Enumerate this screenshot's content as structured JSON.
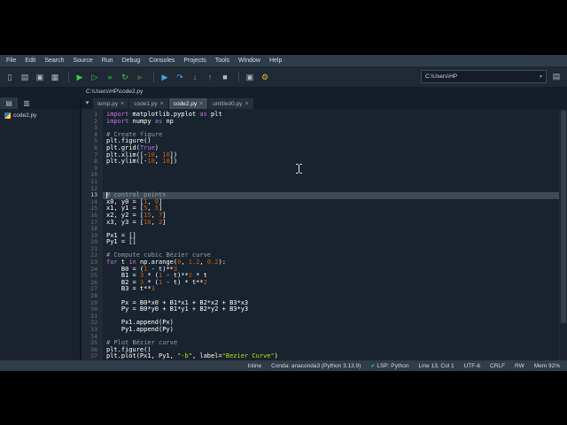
{
  "menu": [
    "File",
    "Edit",
    "Search",
    "Source",
    "Run",
    "Debug",
    "Consoles",
    "Projects",
    "Tools",
    "Window",
    "Help"
  ],
  "toolbar": {
    "working_dir": "C:\\Users\\HP",
    "icons": [
      {
        "name": "new-file-icon",
        "glyph": "▯",
        "color": "#a9bac6"
      },
      {
        "name": "open-file-icon",
        "glyph": "▤",
        "color": "#a9bac6"
      },
      {
        "name": "save-file-icon",
        "glyph": "▣",
        "color": "#a9bac6"
      },
      {
        "name": "save-all-icon",
        "glyph": "▦",
        "color": "#a9bac6"
      },
      {
        "sep": true
      },
      {
        "name": "run-file-icon",
        "glyph": "▶",
        "color": "#45c545"
      },
      {
        "name": "run-cell-icon",
        "glyph": "▷",
        "color": "#45c545"
      },
      {
        "name": "run-cell-advance-icon",
        "glyph": "»",
        "color": "#45c545"
      },
      {
        "name": "rerun-cell-icon",
        "glyph": "↻",
        "color": "#45c545"
      },
      {
        "name": "run-selection-icon",
        "glyph": "▹",
        "color": "#45c545"
      },
      {
        "sep": true
      },
      {
        "name": "debug-file-icon",
        "glyph": "▶",
        "color": "#4aa3df"
      },
      {
        "name": "step-over-icon",
        "glyph": "↷",
        "color": "#4aa3df"
      },
      {
        "name": "step-into-icon",
        "glyph": "↓",
        "color": "#4aa3df"
      },
      {
        "name": "step-out-icon",
        "glyph": "↑",
        "color": "#4aa3df"
      },
      {
        "name": "stop-debug-icon",
        "glyph": "■",
        "color": "#a9bac6"
      },
      {
        "sep": true
      },
      {
        "name": "maximize-pane-icon",
        "glyph": "▣",
        "color": "#a9bac6"
      },
      {
        "name": "preferences-icon",
        "glyph": "⚙",
        "color": "#ddb62b"
      }
    ]
  },
  "pathbar": {
    "path": "C:\\Users\\HP\\code2.py"
  },
  "sidebar": {
    "tabs": [
      {
        "name": "sidebar-tab-1",
        "icon_name": "pane-list-icon",
        "glyph": "▤"
      },
      {
        "name": "sidebar-tab-2",
        "icon_name": "pane-grid-icon",
        "glyph": "▥"
      }
    ],
    "items": [
      {
        "label": "code2.py"
      }
    ]
  },
  "editor": {
    "tabs": [
      {
        "label": "temp.py",
        "active": false
      },
      {
        "label": "code1.py",
        "active": false
      },
      {
        "label": "code2.py",
        "active": true
      },
      {
        "label": "untitled0.py",
        "active": false
      }
    ],
    "current_line": 13,
    "lines": [
      {
        "n": 1,
        "t": [
          [
            "k",
            "import"
          ],
          [
            "n",
            " matplotlib.pyplot "
          ],
          [
            "k",
            "as"
          ],
          [
            "n",
            " plt"
          ]
        ]
      },
      {
        "n": 2,
        "t": [
          [
            "k",
            "import"
          ],
          [
            "n",
            " numpy "
          ],
          [
            "k",
            "as"
          ],
          [
            "n",
            " np"
          ]
        ]
      },
      {
        "n": 3,
        "t": []
      },
      {
        "n": 4,
        "t": [
          [
            "c",
            "# Create figure"
          ]
        ]
      },
      {
        "n": 5,
        "t": [
          [
            "n",
            "plt.figure()"
          ]
        ]
      },
      {
        "n": 6,
        "t": [
          [
            "n",
            "plt.grid("
          ],
          [
            "k",
            "True"
          ],
          [
            "n",
            ")"
          ]
        ]
      },
      {
        "n": 7,
        "t": [
          [
            "n",
            "plt.xlim([-"
          ],
          [
            "d",
            "10"
          ],
          [
            "n",
            ", "
          ],
          [
            "d",
            "10"
          ],
          [
            "n",
            "])"
          ]
        ]
      },
      {
        "n": 8,
        "t": [
          [
            "n",
            "plt.ylim([-"
          ],
          [
            "d",
            "10"
          ],
          [
            "n",
            ", "
          ],
          [
            "d",
            "10"
          ],
          [
            "n",
            "])"
          ]
        ]
      },
      {
        "n": 9,
        "t": []
      },
      {
        "n": 10,
        "t": []
      },
      {
        "n": 11,
        "t": []
      },
      {
        "n": 12,
        "t": []
      },
      {
        "n": 13,
        "t": [
          [
            "c",
            "# control points"
          ]
        ]
      },
      {
        "n": 14,
        "t": [
          [
            "n",
            "x0, y0 = ["
          ],
          [
            "d",
            "1"
          ],
          [
            "n",
            ", "
          ],
          [
            "d",
            "0"
          ],
          [
            "n",
            "]"
          ]
        ]
      },
      {
        "n": 15,
        "t": [
          [
            "n",
            "x1, y1 = ["
          ],
          [
            "d",
            "5"
          ],
          [
            "n",
            ", "
          ],
          [
            "d",
            "5"
          ],
          [
            "n",
            "]"
          ]
        ]
      },
      {
        "n": 16,
        "t": [
          [
            "n",
            "x2, y2 = ["
          ],
          [
            "d",
            "15"
          ],
          [
            "n",
            ", "
          ],
          [
            "d",
            "7"
          ],
          [
            "n",
            "]"
          ]
        ]
      },
      {
        "n": 17,
        "t": [
          [
            "n",
            "x3, y3 = ["
          ],
          [
            "d",
            "10"
          ],
          [
            "n",
            ", "
          ],
          [
            "d",
            "2"
          ],
          [
            "n",
            "]"
          ]
        ]
      },
      {
        "n": 18,
        "t": []
      },
      {
        "n": 19,
        "t": [
          [
            "n",
            "Px1 = []"
          ]
        ]
      },
      {
        "n": 20,
        "t": [
          [
            "n",
            "Py1 = []"
          ]
        ]
      },
      {
        "n": 21,
        "t": []
      },
      {
        "n": 22,
        "t": [
          [
            "c",
            "# Compute cubic Bézier curve"
          ]
        ]
      },
      {
        "n": 23,
        "t": [
          [
            "k",
            "for"
          ],
          [
            "n",
            " t "
          ],
          [
            "k",
            "in"
          ],
          [
            "n",
            " np.arange("
          ],
          [
            "d",
            "0"
          ],
          [
            "n",
            ", "
          ],
          [
            "d",
            "1.2"
          ],
          [
            "n",
            ", "
          ],
          [
            "d",
            "0.2"
          ],
          [
            "n",
            "):"
          ]
        ]
      },
      {
        "n": 24,
        "t": [
          [
            "n",
            "    B0 = ("
          ],
          [
            "d",
            "1"
          ],
          [
            "n",
            " - t)**"
          ],
          [
            "d",
            "3"
          ]
        ]
      },
      {
        "n": 25,
        "t": [
          [
            "n",
            "    B1 = "
          ],
          [
            "d",
            "3"
          ],
          [
            "n",
            " * ("
          ],
          [
            "d",
            "1"
          ],
          [
            "n",
            " - t)**"
          ],
          [
            "d",
            "2"
          ],
          [
            "n",
            " * t"
          ]
        ]
      },
      {
        "n": 26,
        "t": [
          [
            "n",
            "    B2 = "
          ],
          [
            "d",
            "3"
          ],
          [
            "n",
            " * ("
          ],
          [
            "d",
            "1"
          ],
          [
            "n",
            " - t) * t**"
          ],
          [
            "d",
            "2"
          ]
        ]
      },
      {
        "n": 27,
        "t": [
          [
            "n",
            "    B3 = t**"
          ],
          [
            "d",
            "3"
          ]
        ]
      },
      {
        "n": 28,
        "t": []
      },
      {
        "n": 29,
        "t": [
          [
            "n",
            "    Px = B0*x0 + B1*x1 + B2*x2 + B3*x3"
          ]
        ]
      },
      {
        "n": 30,
        "t": [
          [
            "n",
            "    Py = B0*y0 + B1*y1 + B2*y2 + B3*y3"
          ]
        ]
      },
      {
        "n": 31,
        "t": []
      },
      {
        "n": 32,
        "t": [
          [
            "n",
            "    Px1.append(Px)"
          ]
        ]
      },
      {
        "n": 33,
        "t": [
          [
            "n",
            "    Py1.append(Py)"
          ]
        ]
      },
      {
        "n": 34,
        "t": []
      },
      {
        "n": 35,
        "t": [
          [
            "c",
            "# Plot Bézier curve"
          ]
        ]
      },
      {
        "n": 36,
        "t": [
          [
            "n",
            "plt.figure()"
          ]
        ]
      },
      {
        "n": 37,
        "t": [
          [
            "n",
            "plt.plot(Px1, Py1, "
          ],
          [
            "s",
            "\"-b\""
          ],
          [
            "n",
            ", label="
          ],
          [
            "s",
            "\"Bezier Curve\""
          ],
          [
            "n",
            ")"
          ]
        ]
      }
    ]
  },
  "statusbar": {
    "items": [
      {
        "name": "backend-status",
        "text": "Inline"
      },
      {
        "name": "conda-env-status",
        "text": "Conda: anaconda3 (Python 3.13.9)"
      },
      {
        "name": "lsp-status",
        "text": "LSP: Python",
        "icon": "✔",
        "icon_name": "check-icon",
        "icon_color": "#2ecc71"
      },
      {
        "name": "cursor-position-status",
        "text": "Line 13, Col 1"
      },
      {
        "name": "encoding-status",
        "text": "UTF-8"
      },
      {
        "name": "eol-status",
        "text": "CRLF"
      },
      {
        "name": "permissions-status",
        "text": "RW"
      },
      {
        "name": "memory-status",
        "text": "Mem 92%"
      }
    ]
  },
  "syntax_colors": {
    "k": "#c670e0",
    "n": "#ffffff",
    "c": "#87a096",
    "s": "#b0e313",
    "d": "#c65d09"
  },
  "colors": {
    "app_bg": "#19232d",
    "chrome_bg": "#2e3d48",
    "toolbar_bg": "#1f2933",
    "gutter_bg": "#222b35",
    "current_line": "#3d4956",
    "tab_active": "#3b4a56",
    "run_green": "#45c545",
    "debug_blue": "#4aa3df",
    "keyword": "#c670e0",
    "string": "#b0e313",
    "number": "#c65d09",
    "comment": "#87a096"
  }
}
